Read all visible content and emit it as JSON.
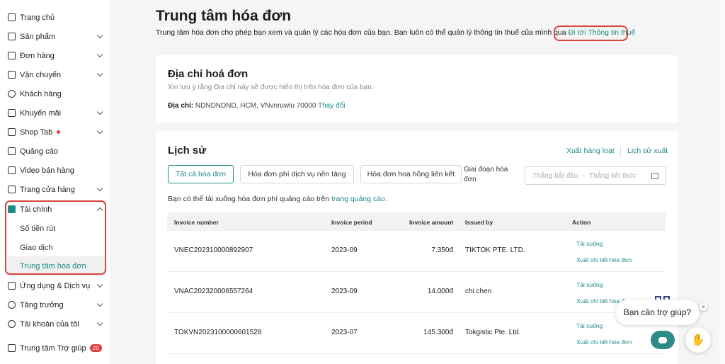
{
  "sidebar": {
    "items": [
      {
        "label": "Trang chủ",
        "chevron": false
      },
      {
        "label": "Sản phẩm",
        "chevron": true
      },
      {
        "label": "Đơn hàng",
        "chevron": true
      },
      {
        "label": "Vận chuyển",
        "chevron": true
      },
      {
        "label": "Khách hàng",
        "chevron": false
      },
      {
        "label": "Khuyến mãi",
        "chevron": true
      },
      {
        "label": "Shop Tab",
        "chevron": true
      },
      {
        "label": "Quảng cáo",
        "chevron": false
      },
      {
        "label": "Video bán hàng",
        "chevron": false
      },
      {
        "label": "Trang cửa hàng",
        "chevron": true
      },
      {
        "label": "Tài chính",
        "chevron": true
      }
    ],
    "finance_sub": [
      "Số tiền rút",
      "Giao dịch",
      "Trung tâm hóa đơn"
    ],
    "items_after": [
      {
        "label": "Ứng dụng & Dịch vụ"
      },
      {
        "label": "Tăng trưởng"
      },
      {
        "label": "Tài khoản của tôi"
      }
    ],
    "help": {
      "label": "Trung tâm Trợ giúp",
      "badge": "29"
    }
  },
  "header": {
    "title": "Trung tâm hóa đơn",
    "desc": "Trung tâm hóa đơn cho phép bạn xem và quản lý các hóa đơn của bạn. Bạn luôn có thể quản lý thông tin thuế của mình qua",
    "link": "Đi tới Thông tin thuế"
  },
  "address": {
    "title": "Địa chỉ hoá đơn",
    "note": "Xin lưu ý rằng Địa chỉ này sẽ được hiển thị trên hóa đơn của bạn.",
    "label": "Địa chỉ:",
    "value": "NDNDNDND, HCM, VNvnruwiu 70000",
    "change": "Thay đổi"
  },
  "history": {
    "title": "Lịch sử",
    "export_bulk": "Xuất hàng loạt",
    "export_history": "Lịch sử xuất",
    "tabs": [
      "Tất cả hóa đơn",
      "Hóa đơn phí dịch vụ nền tảng",
      "Hóa đơn hoa hồng liên kết"
    ],
    "period_label": "Giai đoạn hóa đơn",
    "start_placeholder": "Thẳng bắt đầu",
    "end_placeholder": "Thẳng kết thúc",
    "range_sep": "-",
    "note": "Bạn có thể tải xuống hóa đơn phí quảng cáo trên",
    "note_link": "trang quảng cáo.",
    "columns": [
      "Invoice number",
      "Invoice period",
      "Invoice amount",
      "Issued by",
      "Action"
    ],
    "rows": [
      {
        "number": "VNEC202310000892907",
        "period": "2023-09",
        "amount": "7.350đ",
        "issuer": "TIKTOK PTE. LTD.",
        "a1": "Tải xuống",
        "a2": "Xuất chi tiết hóa đơn"
      },
      {
        "number": "VNAC202320006557264",
        "period": "2023-09",
        "amount": "14.000đ",
        "issuer": "chi chen",
        "a1": "Tải xuống",
        "a2": "Xuất chi tiết hóa đơn"
      },
      {
        "number": "TOKVN2023100000601528",
        "period": "2023-07",
        "amount": "145.300đ",
        "issuer": "Tokgistic Pte. Ltd.",
        "a1": "Tải xuống",
        "a2": "Xuất chi tiết hóa đơn"
      }
    ]
  },
  "support": {
    "bubble": "Bạn cần trợ giúp?",
    "close": "×"
  }
}
